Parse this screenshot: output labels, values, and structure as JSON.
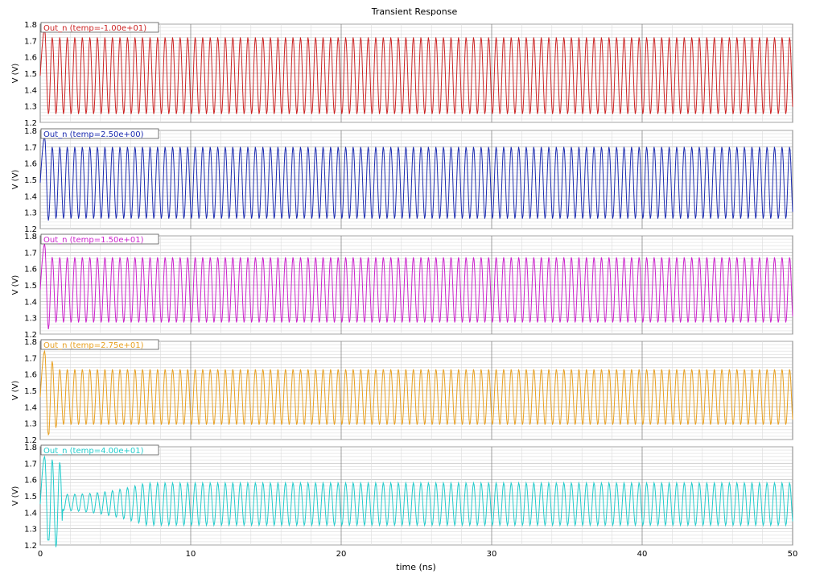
{
  "chart_data": {
    "type": "line",
    "title": "Transient Response",
    "xlabel": "time (ns)",
    "xlim": [
      0,
      50
    ],
    "xticks": [
      "0",
      "10",
      "20",
      "30",
      "40",
      "50"
    ],
    "x_unit": "ns",
    "grid": true,
    "legend_position": "top-left",
    "panels": [
      {
        "name": "Out_n (temp=-1.00e+01)",
        "ylabel": "V (V)",
        "ylim": [
          1.2,
          1.8
        ],
        "yticks": [
          "1.8",
          "1.7",
          "1.6",
          "1.5",
          "1.4",
          "1.3",
          "1.2"
        ],
        "color": "#cc2222",
        "initial_peak": 1.77,
        "initial_trough": 1.23,
        "osc_high": 1.72,
        "osc_low": 1.25,
        "period_ns": 0.5,
        "settle_ns": 0.5
      },
      {
        "name": "Out_n (temp=2.50e+00)",
        "ylabel": "V (V)",
        "ylim": [
          1.2,
          1.8
        ],
        "yticks": [
          "1.8",
          "1.7",
          "1.6",
          "1.5",
          "1.4",
          "1.3",
          "1.2"
        ],
        "color": "#1a2ab0",
        "initial_peak": 1.76,
        "initial_trough": 1.23,
        "osc_high": 1.7,
        "osc_low": 1.26,
        "period_ns": 0.5,
        "settle_ns": 0.6
      },
      {
        "name": "Out_n (temp=1.50e+01)",
        "ylabel": "V (V)",
        "ylim": [
          1.2,
          1.8
        ],
        "yticks": [
          "1.8",
          "1.7",
          "1.6",
          "1.5",
          "1.4",
          "1.3",
          "1.2"
        ],
        "color": "#cc22cc",
        "initial_peak": 1.75,
        "initial_trough": 1.23,
        "osc_high": 1.67,
        "osc_low": 1.27,
        "period_ns": 0.5,
        "settle_ns": 0.8
      },
      {
        "name": "Out_n (temp=2.75e+01)",
        "ylabel": "V (V)",
        "ylim": [
          1.2,
          1.8
        ],
        "yticks": [
          "1.8",
          "1.7",
          "1.6",
          "1.5",
          "1.4",
          "1.3",
          "1.2"
        ],
        "color": "#e8a020",
        "initial_peak": 1.74,
        "initial_trough": 1.23,
        "osc_high": 1.63,
        "osc_low": 1.29,
        "period_ns": 0.5,
        "settle_ns": 1.2
      },
      {
        "name": "Out_n (temp=4.00e+01)",
        "ylabel": "V (V)",
        "ylim": [
          1.2,
          1.8
        ],
        "yticks": [
          "1.8",
          "1.7",
          "1.6",
          "1.5",
          "1.4",
          "1.3",
          "1.2"
        ],
        "color": "#22cccc",
        "initial_peak": 1.74,
        "initial_trough": 1.23,
        "osc_high": 1.58,
        "osc_low": 1.32,
        "period_ns": 0.5,
        "settle_ns": 5.0,
        "dip_center": 1.46,
        "dip_amplitude": 0.05,
        "dip_until_ns": 7.0
      }
    ]
  }
}
